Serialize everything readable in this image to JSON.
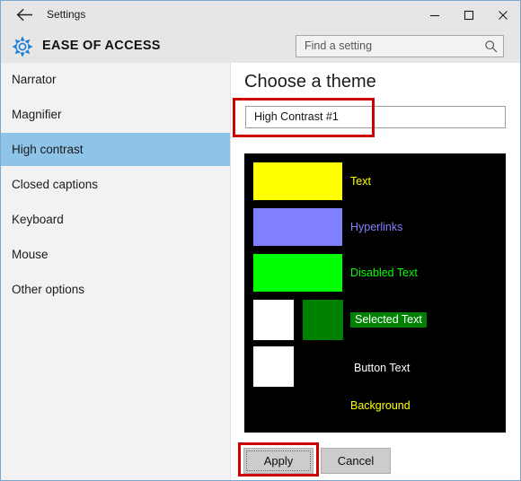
{
  "window": {
    "titlebar": {
      "back_icon": "back-arrow-icon",
      "title": "Settings",
      "minimize_label": "minimize-icon",
      "maximize_label": "maximize-icon",
      "close_label": "close-icon"
    },
    "header": {
      "icon": "gear-icon",
      "title": "EASE OF ACCESS",
      "search": {
        "placeholder": "Find a setting",
        "value": "",
        "icon": "search-icon"
      }
    }
  },
  "sidebar": {
    "items": [
      {
        "label": "Narrator",
        "selected": false
      },
      {
        "label": "Magnifier",
        "selected": false
      },
      {
        "label": "High contrast",
        "selected": true
      },
      {
        "label": "Closed captions",
        "selected": false
      },
      {
        "label": "Keyboard",
        "selected": false
      },
      {
        "label": "Mouse",
        "selected": false
      },
      {
        "label": "Other options",
        "selected": false
      }
    ],
    "selected_color": "#8ec4e8"
  },
  "main": {
    "page_title": "Choose a theme",
    "theme_dropdown": {
      "value": "High Contrast #1",
      "options": [
        "High Contrast #1"
      ]
    },
    "preview": {
      "background_color": "#000000",
      "rows": [
        {
          "label": "Text",
          "label_color": "#ffff00",
          "swatches": [
            {
              "color": "#ffff00"
            }
          ]
        },
        {
          "label": "Hyperlinks",
          "label_color": "#8080ff",
          "swatches": [
            {
              "color": "#8080ff"
            }
          ]
        },
        {
          "label": "Disabled Text",
          "label_color": "#00ff00",
          "swatches": [
            {
              "color": "#00ff00"
            }
          ]
        },
        {
          "label": "Selected Text",
          "label_color": "#ffffff",
          "label_background": "#008000",
          "swatches": [
            {
              "color": "#ffffff"
            },
            {
              "color": "#008000"
            }
          ]
        },
        {
          "label": "Button Text",
          "label_color": "#ffffff",
          "swatches": [
            {
              "color": "#ffffff"
            }
          ]
        },
        {
          "label": "Background",
          "label_color": "#ffff00",
          "swatches": []
        }
      ]
    },
    "buttons": {
      "apply": "Apply",
      "cancel": "Cancel"
    }
  },
  "annotations": {
    "highlight_color": "#cc0000",
    "boxes": [
      "theme-dropdown",
      "apply-button"
    ]
  }
}
